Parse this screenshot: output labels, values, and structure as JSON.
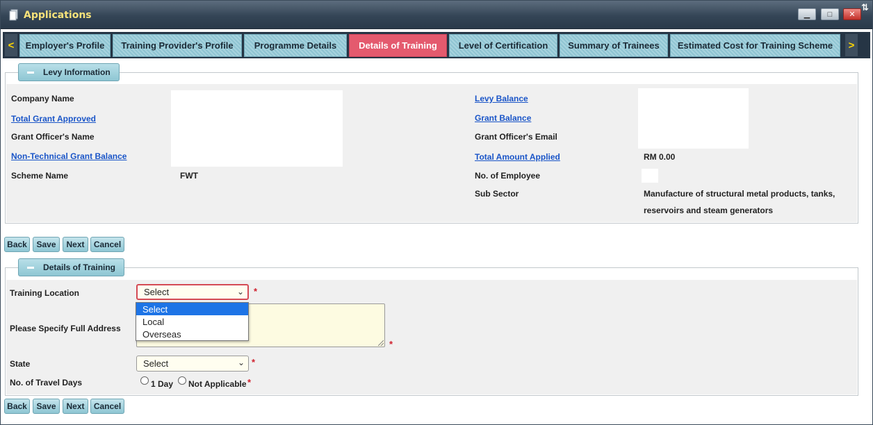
{
  "window": {
    "title": "Applications",
    "controls": {
      "minimize": "▁",
      "maximize": "□",
      "close": "✕"
    }
  },
  "tabs": {
    "prev": "<",
    "next": ">",
    "items": [
      {
        "label": "Employer's Profile"
      },
      {
        "label": "Training Provider's Profile"
      },
      {
        "label": "Programme Details"
      },
      {
        "label": "Details of Training"
      },
      {
        "label": "Level of Certification"
      },
      {
        "label": "Summary of Trainees"
      },
      {
        "label": "Estimated Cost for Training Scheme"
      }
    ],
    "active_index": 3
  },
  "levy": {
    "legend": "Levy Information",
    "company_name": "Company Name",
    "total_grant_approved": "Total Grant Approved",
    "grant_officer_name": "Grant Officer's Name",
    "non_technical_grant_balance": "Non-Technical Grant Balance",
    "scheme_name": "Scheme Name",
    "scheme_name_value": "FWT",
    "levy_balance": "Levy Balance",
    "grant_balance": "Grant Balance",
    "grant_officer_email": "Grant Officer's Email",
    "total_amount_applied": "Total Amount Applied",
    "total_amount_applied_value": "RM 0.00",
    "no_of_employee": "No. of Employee",
    "sub_sector": "Sub Sector",
    "sub_sector_value_line1": "Manufacture of structural metal products, tanks,",
    "sub_sector_value_line2": "reservoirs and steam generators"
  },
  "buttons": {
    "back": "Back",
    "save": "Save",
    "next": "Next",
    "cancel": "Cancel"
  },
  "training": {
    "legend": "Details of Training",
    "location_label": "Training Location",
    "location_value": "Select",
    "location_options": [
      "Select",
      "Local",
      "Overseas"
    ],
    "address_label": "Please Specify Full Address",
    "state_label": "State",
    "state_value": "Select",
    "travel_days_label": "No. of Travel Days",
    "travel_options": [
      "1 Day",
      "Not Applicable"
    ],
    "required_mark": "*"
  }
}
